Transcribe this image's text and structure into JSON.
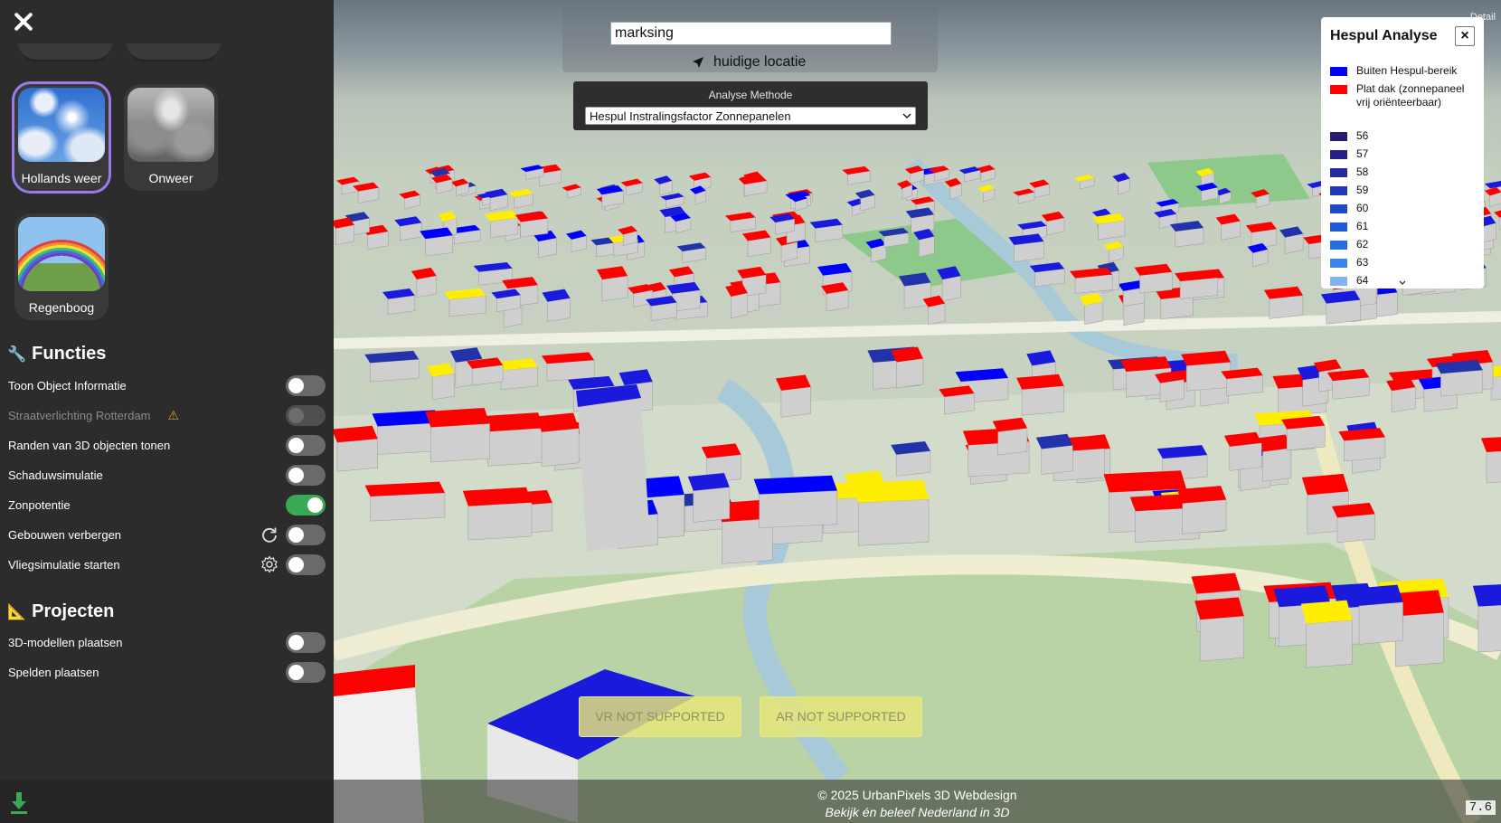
{
  "sidebar": {
    "weather_presets": [
      {
        "label": "Hollands weer",
        "selected": true
      },
      {
        "label": "Onweer",
        "selected": false
      },
      {
        "label": "Regenboog",
        "selected": false
      }
    ],
    "functies_title": "Functies",
    "functies": [
      {
        "label": "Toon Object Informatie",
        "enabled": false
      },
      {
        "label": "Straatverlichting Rotterdam",
        "enabled": false,
        "disabled": true,
        "icon": "warning-icon"
      },
      {
        "label": "Randen van 3D objecten tonen",
        "enabled": false
      },
      {
        "label": "Schaduwsimulatie",
        "enabled": false
      },
      {
        "label": "Zonpotentie",
        "enabled": true
      },
      {
        "label": "Gebouwen verbergen",
        "enabled": false,
        "icon": "refresh-icon"
      },
      {
        "label": "Vliegsimulatie starten",
        "enabled": false,
        "icon": "gear-icon"
      }
    ],
    "projecten_title": "Projecten",
    "projecten": [
      {
        "label": "3D-modellen plaatsen",
        "enabled": false
      },
      {
        "label": "Spelden plaatsen",
        "enabled": false
      }
    ]
  },
  "search": {
    "value": "marksing",
    "location_label": "huidige locatie"
  },
  "analyse": {
    "label": "Analyse Methode",
    "selected": "Hespul Instralingsfactor Zonnepanelen"
  },
  "legend": {
    "title": "Hespul Analyse",
    "close_label": "×",
    "entries": [
      {
        "label": "Buiten Hespul-bereik",
        "color": "#0000ff"
      },
      {
        "label": "Plat dak (zonnepaneel vrij oriënteerbaar)",
        "color": "#ff0000"
      },
      {
        "label": "56",
        "color": "#2a1a6e"
      },
      {
        "label": "57",
        "color": "#2a1f85"
      },
      {
        "label": "58",
        "color": "#262a9c"
      },
      {
        "label": "59",
        "color": "#2238b4"
      },
      {
        "label": "60",
        "color": "#1e48c8"
      },
      {
        "label": "61",
        "color": "#1c5ad6"
      },
      {
        "label": "62",
        "color": "#226fe0"
      },
      {
        "label": "63",
        "color": "#3a86e6"
      },
      {
        "label": "64",
        "color": "#7fb4ee"
      }
    ]
  },
  "xr": {
    "vr_label": "VR NOT SUPPORTED",
    "ar_label": "AR NOT SUPPORTED"
  },
  "footer": {
    "credit": "© 2025 UrbanPixels 3D Webdesign",
    "tagline": "Bekijk én beleef Nederland in 3D"
  },
  "map": {
    "version": "7.6",
    "detail_label": "Detail"
  }
}
